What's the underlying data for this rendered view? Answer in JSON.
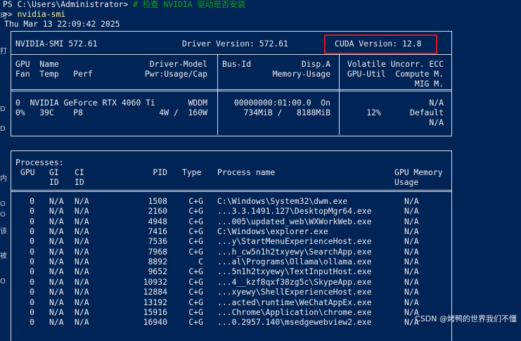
{
  "terminal": {
    "prompt_line": {
      "prompt": "PS C:\\Users\\Administrator> ",
      "comment": "# 检查 NVIDIA 驱动是否安装"
    },
    "command_line": {
      "marker": ">> ",
      "command": "nvidia-smi"
    },
    "timestamp": "Thu Mar 13 22:09:42 2025"
  },
  "smi": {
    "title": "NVIDIA-SMI 572.61",
    "driver_version": "Driver Version: 572.61",
    "cuda_version": "CUDA Version: 12.8",
    "header": {
      "c1_l1": "GPU  Name",
      "c1_r1": "Driver-Model",
      "c1_l2": "Fan  Temp   Perf",
      "c1_r2": "Pwr:Usage/Cap",
      "c2_l1": "Bus-Id",
      "c2_r1": "Disp.A",
      "c2_r2": "Memory-Usage",
      "c3_r1": "Volatile Uncorr. ECC",
      "c3_r2": "GPU-Util  Compute M.",
      "c3_r3": "MIG M."
    },
    "gpu": {
      "c1_l1": "0  NVIDIA GeForce RTX 4060 Ti",
      "c1_r1": "WDDM",
      "c1_l2": "0%   39C    P8",
      "c1_r2": "4W /  160W",
      "c2_r1": "00000000:01:00.0  On",
      "c2_r2": "734MiB /   8188MiB",
      "c3_r1": "N/A",
      "c3_r2": "12%      Default",
      "c3_r3": "N/A"
    }
  },
  "processes": {
    "title": "Processes:",
    "header": {
      "gpu": "GPU",
      "gi": "GI",
      "ci": "CI",
      "gi2": "ID",
      "ci2": "ID",
      "pid": "PID",
      "type": "Type",
      "name": "Process name",
      "mem": "GPU Memory",
      "mem2": "Usage"
    },
    "rows": [
      {
        "gpu": "0",
        "gi": "N/A",
        "ci": "N/A",
        "pid": "1508",
        "type": "C+G",
        "name": "C:\\Windows\\System32\\dwm.exe",
        "mem": "N/A"
      },
      {
        "gpu": "0",
        "gi": "N/A",
        "ci": "N/A",
        "pid": "2160",
        "type": "C+G",
        "name": "...3.3.1491.127\\DesktopMgr64.exe",
        "mem": "N/A"
      },
      {
        "gpu": "0",
        "gi": "N/A",
        "ci": "N/A",
        "pid": "4948",
        "type": "C+G",
        "name": "...005\\updated_web\\WXWorkWeb.exe",
        "mem": "N/A"
      },
      {
        "gpu": "0",
        "gi": "N/A",
        "ci": "N/A",
        "pid": "7416",
        "type": "C+G",
        "name": "C:\\Windows\\explorer.exe",
        "mem": "N/A"
      },
      {
        "gpu": "0",
        "gi": "N/A",
        "ci": "N/A",
        "pid": "7536",
        "type": "C+G",
        "name": "...y\\StartMenuExperienceHost.exe",
        "mem": "N/A"
      },
      {
        "gpu": "0",
        "gi": "N/A",
        "ci": "N/A",
        "pid": "7968",
        "type": "C+G",
        "name": "...h_cw5n1h2txyewy\\SearchApp.exe",
        "mem": "N/A"
      },
      {
        "gpu": "0",
        "gi": "N/A",
        "ci": "N/A",
        "pid": "8892",
        "type": "C",
        "name": "...al\\Programs\\Ollama\\ollama.exe",
        "mem": "N/A"
      },
      {
        "gpu": "0",
        "gi": "N/A",
        "ci": "N/A",
        "pid": "9652",
        "type": "C+G",
        "name": "...5n1h2txyewy\\TextInputHost.exe",
        "mem": "N/A"
      },
      {
        "gpu": "0",
        "gi": "N/A",
        "ci": "N/A",
        "pid": "10932",
        "type": "C+G",
        "name": "...4__kzf8qxf38zg5c\\SkypeApp.exe",
        "mem": "N/A"
      },
      {
        "gpu": "0",
        "gi": "N/A",
        "ci": "N/A",
        "pid": "12884",
        "type": "C+G",
        "name": "...xyewy\\ShellExperienceHost.exe",
        "mem": "N/A"
      },
      {
        "gpu": "0",
        "gi": "N/A",
        "ci": "N/A",
        "pid": "13192",
        "type": "C+G",
        "name": "...acted\\runtime\\WeChatAppEx.exe",
        "mem": "N/A"
      },
      {
        "gpu": "0",
        "gi": "N/A",
        "ci": "N/A",
        "pid": "15916",
        "type": "C+G",
        "name": "...Chrome\\Application\\chrome.exe",
        "mem": "N/A"
      },
      {
        "gpu": "0",
        "gi": "N/A",
        "ci": "N/A",
        "pid": "16940",
        "type": "C+G",
        "name": "...0.2957.140\\msedgewebview2.exe",
        "mem": "N/A"
      }
    ]
  },
  "watermark": "CSDN @烤鸭的世界我们不懂",
  "side_chars": [
    "可",
    "打",
    "D",
    "D",
    "内",
    "O",
    "O",
    "该",
    "被",
    "O"
  ],
  "colors": {
    "background": "#012456",
    "highlight": "#e0171c",
    "comment": "#13a10e",
    "command": "#f9f1a5"
  }
}
